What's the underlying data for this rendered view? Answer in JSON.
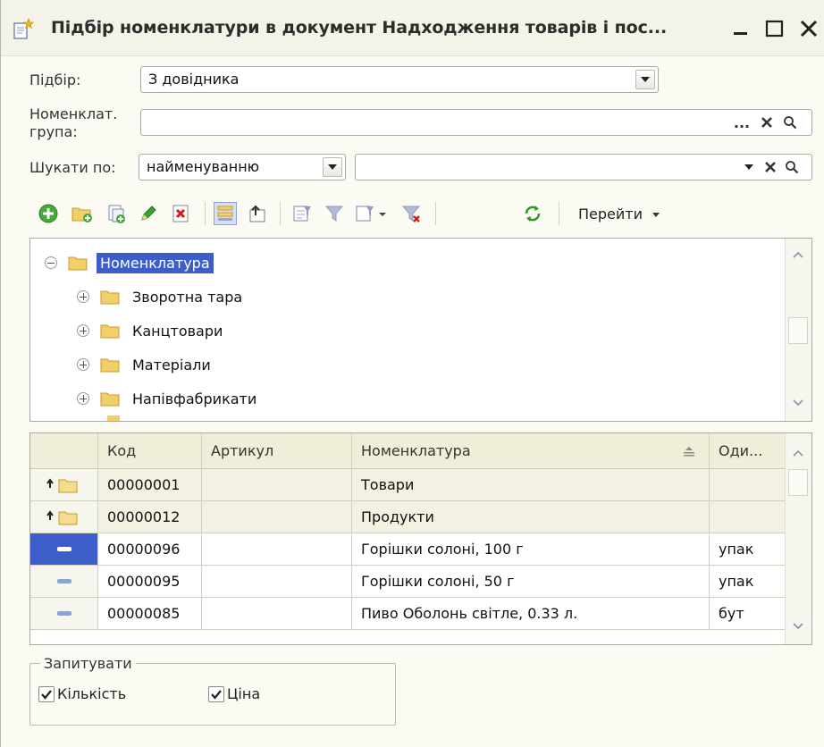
{
  "window": {
    "title": "Підбір номенклатури в документ Надходження товарів і пос..."
  },
  "form": {
    "selection_label": "Підбір:",
    "selection_value": "З довідника",
    "group_label_line1": "Номенклат.",
    "group_label_line2": "група:",
    "group_value": "",
    "group_btn_dots": "...",
    "search_label": "Шукати по:",
    "search_by_value": "найменуванню",
    "search_value": ""
  },
  "toolbar": {
    "goto_label": "Перейти"
  },
  "tree": {
    "items": [
      {
        "label": "Номенклатура"
      },
      {
        "label": "Зворотна тара"
      },
      {
        "label": "Канцтовари"
      },
      {
        "label": "Матеріали"
      },
      {
        "label": "Напівфабрикати"
      }
    ]
  },
  "table": {
    "headers": {
      "code": "Код",
      "article": "Артикул",
      "name": "Номенклатура",
      "unit": "Оди..."
    },
    "rows": [
      {
        "code": "00000001",
        "article": "",
        "name": "Товари",
        "unit": ""
      },
      {
        "code": "00000012",
        "article": "",
        "name": "Продукти",
        "unit": ""
      },
      {
        "code": "00000096",
        "article": "",
        "name": "Горішки солоні, 100 г",
        "unit": "упак"
      },
      {
        "code": "00000095",
        "article": "",
        "name": "Горішки солоні, 50 г",
        "unit": "упак"
      },
      {
        "code": "00000085",
        "article": "",
        "name": "Пиво Оболонь світле, 0.33 л.",
        "unit": "бут"
      }
    ]
  },
  "ask": {
    "legend": "Запитувати",
    "quantity_label": "Кількість",
    "price_label": "Ціна"
  },
  "colors": {
    "selection": "#3d5ec8",
    "folder": "#f3cf6a",
    "header_bg": "#efefd9"
  }
}
